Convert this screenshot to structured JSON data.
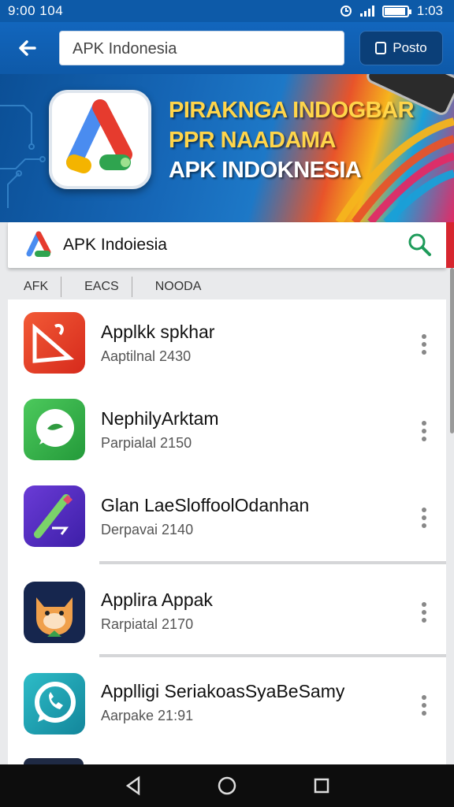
{
  "status_bar": {
    "time": "9:00 104",
    "clock": "1:03"
  },
  "app_bar": {
    "search_value": "APK Indonesia",
    "post_label": "Posto"
  },
  "banner": {
    "line1": "PIRAKNGA INDOGBAR",
    "line2": "PPR NAADAMA",
    "line3": "APK INDOKNESIA"
  },
  "search_card": {
    "label": "APK Indoiesia"
  },
  "tabs": [
    "AFK",
    "EACS",
    "NOODA"
  ],
  "apps": [
    {
      "name": "Applkk spkhar",
      "sub": "Aaptilnal 2430",
      "icon": "red-document-icon",
      "color": "#e8412c"
    },
    {
      "name": "NephilyArktam",
      "sub": "Parpialal 2150",
      "icon": "chat-bubble-icon",
      "color": "#34b24a"
    },
    {
      "name": "Glan LaeSloffoolOdanhan",
      "sub": "Derpavai 2140",
      "icon": "pen-icon",
      "color": "#5b2fc9"
    },
    {
      "name": "Applira Appak",
      "sub": "Rarpiatal 2170",
      "icon": "cat-icon",
      "color": "#1b2b55"
    },
    {
      "name": "Applligi SeriakoasSyaBeSamy",
      "sub": "Aarpake 21:91",
      "icon": "phone-bubble-icon",
      "color": "#1aa3b4"
    }
  ],
  "colors": {
    "primary": "#1266bd",
    "accent_red": "#d7262f",
    "search_icon": "#1e9b5a"
  }
}
